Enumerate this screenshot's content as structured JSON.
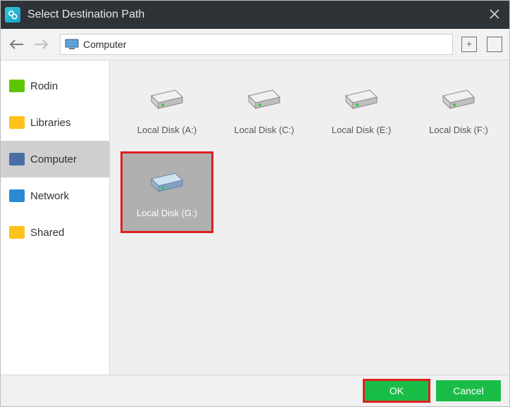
{
  "title": "Select Destination Path",
  "toolbar": {
    "breadcrumb": "Computer"
  },
  "sidebar": {
    "items": [
      {
        "label": "Rodin"
      },
      {
        "label": "Libraries"
      },
      {
        "label": "Computer"
      },
      {
        "label": "Network"
      },
      {
        "label": "Shared"
      }
    ]
  },
  "drives": [
    {
      "label": "Local Disk (A:)"
    },
    {
      "label": "Local Disk (C:)"
    },
    {
      "label": "Local Disk (E:)"
    },
    {
      "label": "Local Disk (F:)"
    },
    {
      "label": "Local Disk (G:)"
    }
  ],
  "buttons": {
    "ok": "OK",
    "cancel": "Cancel"
  }
}
